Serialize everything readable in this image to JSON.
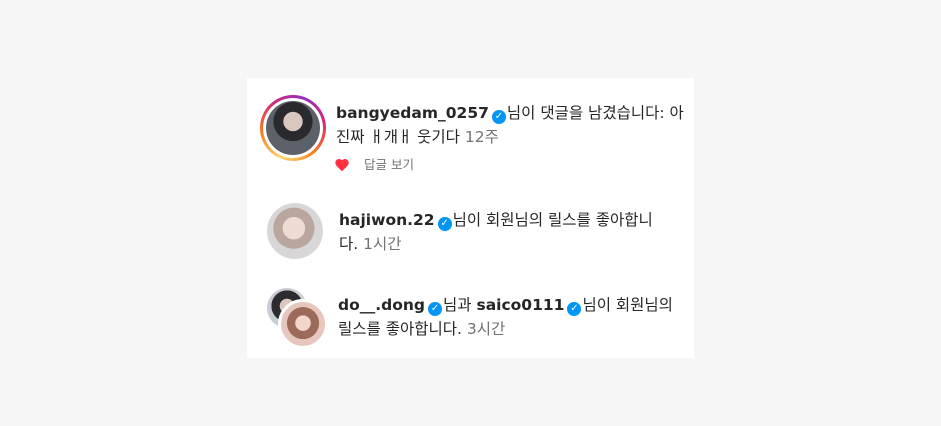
{
  "notifications": [
    {
      "username": "bangyedam_0257",
      "verified": true,
      "message_line1": "님이 댓글을 남겼습니다: 아",
      "message_line2": "진짜 ㅐ개ㅐ 웃기다 ",
      "time": "12주",
      "reply_label": "답글 보기",
      "liked_icon": "heart-filled-icon",
      "accent": "#ff3040"
    },
    {
      "username": "hajiwon.22",
      "verified": true,
      "message_line1": "님이 회원님의 릴스를 좋아합니",
      "message_line2": "다. ",
      "time": "1시간"
    },
    {
      "username": "do__.dong",
      "verified": true,
      "connector": "님과 ",
      "username2": "saico0111",
      "verified2": true,
      "message_line1": "님이 회원님의",
      "message_line2": "릴스를 좋아합니다. ",
      "time": "3시간"
    }
  ],
  "colors": {
    "verified_badge": "#0095f6",
    "secondary_text": "#737373",
    "primary_text": "#262626"
  }
}
